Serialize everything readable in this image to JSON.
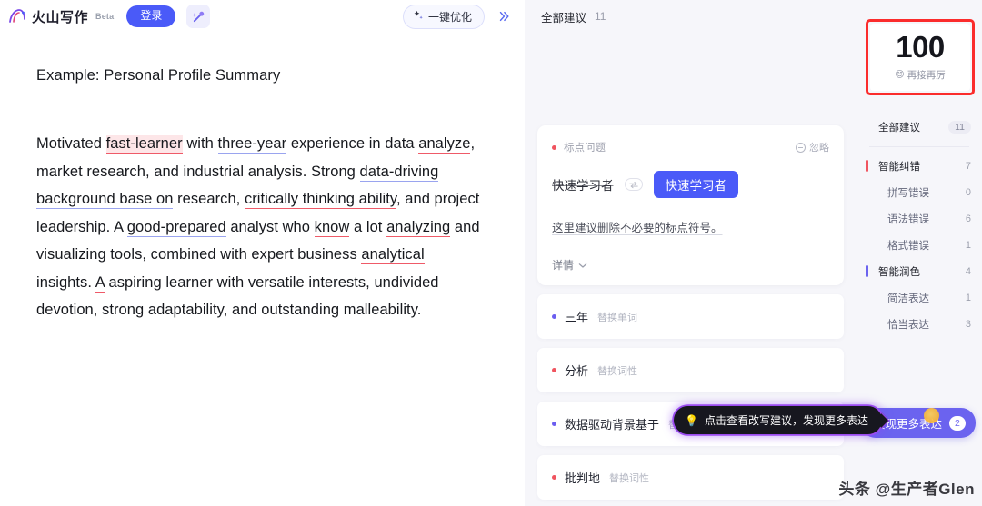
{
  "topbar": {
    "brand_name": "火山写作",
    "beta_label": "Beta",
    "login_label": "登录",
    "magic_icon": "magic-wand-icon",
    "optimize_label": "一键优化",
    "optimize_icon": "sparkle-icon",
    "collapse_icon": "double-chevron-right-icon"
  },
  "document": {
    "title": "Example: Personal Profile Summary",
    "paragraph_segments": [
      {
        "text": "Motivated ",
        "mark": "none"
      },
      {
        "text": "fast-learner",
        "mark": "red-highlight"
      },
      {
        "text": " with ",
        "mark": "none"
      },
      {
        "text": "three-year",
        "mark": "blue"
      },
      {
        "text": " experience in data ",
        "mark": "none"
      },
      {
        "text": "analyze",
        "mark": "red"
      },
      {
        "text": ", market research, and industrial analysis. Strong ",
        "mark": "none"
      },
      {
        "text": "data-driving background base on",
        "mark": "blue"
      },
      {
        "text": " research, ",
        "mark": "none"
      },
      {
        "text": "critically thinking ability",
        "mark": "red"
      },
      {
        "text": ", and project leadership. A ",
        "mark": "none"
      },
      {
        "text": "good-prepared",
        "mark": "blue"
      },
      {
        "text": " analyst who ",
        "mark": "none"
      },
      {
        "text": "know",
        "mark": "red"
      },
      {
        "text": " a lot ",
        "mark": "none"
      },
      {
        "text": "analyzing",
        "mark": "red"
      },
      {
        "text": " and visualizing tools, combined with expert business ",
        "mark": "none"
      },
      {
        "text": "analytical",
        "mark": "red"
      },
      {
        "text": " insights. ",
        "mark": "none"
      },
      {
        "text": "A",
        "mark": "red"
      },
      {
        "text": " aspiring learner with versatile interests, undivided devotion, strong adaptability, and outstanding malleability.",
        "mark": "none"
      }
    ]
  },
  "suggestions_panel": {
    "header_label": "全部建议",
    "header_count": "11",
    "card": {
      "tag": "标点问题",
      "tag_dot_color": "#f0545f",
      "ignore_label": "忽略",
      "ignore_icon": "minus-circle-icon",
      "original": "快速学习者",
      "swap_icon": "swap-arrows-icon",
      "replacement": "快速学习者",
      "description": "这里建议删除不必要的标点符号。",
      "detail_label": "详情",
      "detail_icon": "chevron-down-icon"
    },
    "items": [
      {
        "word": "三年",
        "kind": "替换单词",
        "dot_color": "#6b5ef0"
      },
      {
        "word": "分析",
        "kind": "替换词性",
        "dot_color": "#f0545f"
      },
      {
        "word": "数据驱动背景基于",
        "kind": "替换...",
        "dot_color": "#6b5ef0"
      },
      {
        "word": "批判地",
        "kind": "替换词性",
        "dot_color": "#f0545f"
      }
    ],
    "tooltip": {
      "text": "点击查看改写建议，发现更多表达",
      "icon": "lightbulb-icon"
    },
    "discover_button": {
      "label": "发现更多表达",
      "badge": "2",
      "cursor_icon": "cursor-pointer-icon"
    }
  },
  "sidebar": {
    "score": {
      "value": "100",
      "caption": "再接再厉",
      "emoji_icon": "smile-emoji-icon",
      "highlight_color": "#fb2c2c"
    },
    "rows": [
      {
        "label": "全部建议",
        "count": "11",
        "level": "all",
        "bar": "none"
      },
      {
        "label": "智能纠错",
        "count": "7",
        "level": "group",
        "bar": "red"
      },
      {
        "label": "拼写错误",
        "count": "0",
        "level": "sub",
        "bar": "none"
      },
      {
        "label": "语法错误",
        "count": "6",
        "level": "sub",
        "bar": "none"
      },
      {
        "label": "格式错误",
        "count": "1",
        "level": "sub",
        "bar": "none"
      },
      {
        "label": "智能润色",
        "count": "4",
        "level": "group",
        "bar": "purple"
      },
      {
        "label": "简洁表达",
        "count": "1",
        "level": "sub",
        "bar": "none"
      },
      {
        "label": "恰当表达",
        "count": "3",
        "level": "sub",
        "bar": "none"
      }
    ]
  },
  "watermark": {
    "text": "头条 @生产者Glen"
  }
}
